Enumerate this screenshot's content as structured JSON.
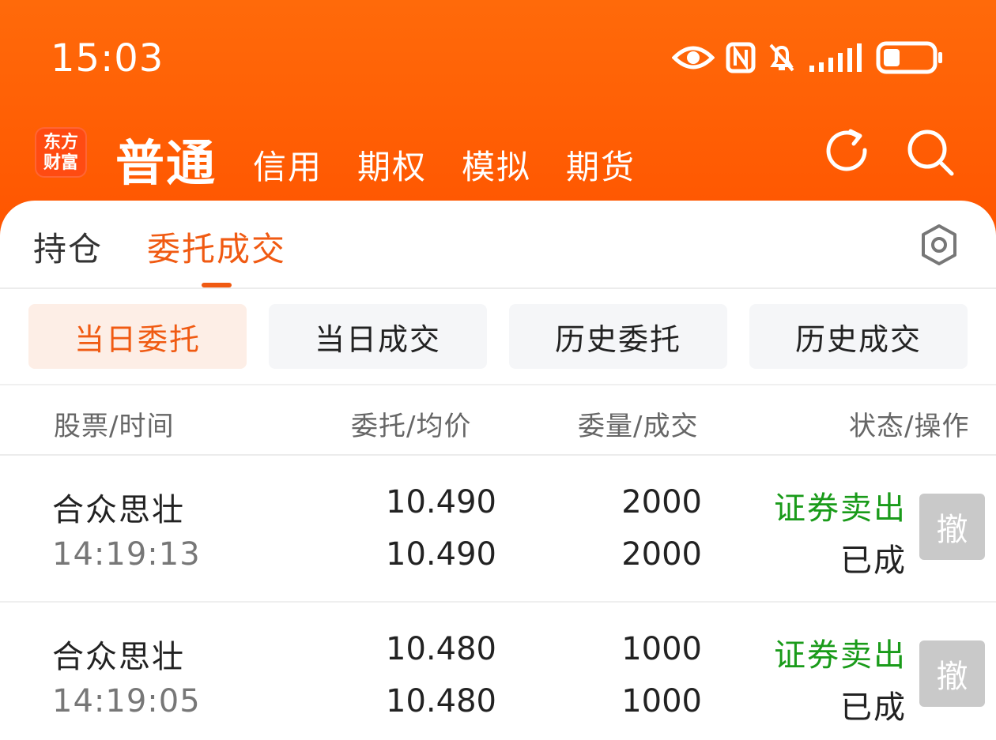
{
  "status_bar": {
    "time": "15:03",
    "icons": [
      "eye-icon",
      "nfc-icon",
      "bell-off-icon",
      "signal-icon",
      "battery-icon"
    ]
  },
  "nav": {
    "logo_line1": "东方",
    "logo_line2": "财富",
    "main": "普通",
    "items": [
      "信用",
      "期权",
      "模拟",
      "期货"
    ],
    "refresh_icon": "refresh-icon",
    "search_icon": "search-icon"
  },
  "tabs": {
    "hold": "持仓",
    "orders": "委托成交",
    "active": "委托成交",
    "settings_icon": "gear-icon"
  },
  "segments": [
    {
      "label": "当日委托",
      "active": true
    },
    {
      "label": "当日成交",
      "active": false
    },
    {
      "label": "历史委托",
      "active": false
    },
    {
      "label": "历史成交",
      "active": false
    }
  ],
  "table": {
    "headers": [
      "股票/时间",
      "委托/均价",
      "委量/成交",
      "状态/操作"
    ],
    "rows": [
      {
        "name": "合众思壮",
        "time": "14:19:13",
        "order_price": "10.490",
        "avg_price": "10.490",
        "order_qty": "2000",
        "filled_qty": "2000",
        "direction": "证券卖出",
        "state": "已成",
        "action": "撤"
      },
      {
        "name": "合众思壮",
        "time": "14:19:05",
        "order_price": "10.480",
        "avg_price": "10.480",
        "order_qty": "1000",
        "filled_qty": "1000",
        "direction": "证券卖出",
        "state": "已成",
        "action": "撤"
      }
    ]
  },
  "colors": {
    "brand": "#ff5a00",
    "accent": "#f05a12",
    "sell_green": "#1a9b1a",
    "disabled_btn": "#c9c9c9"
  }
}
